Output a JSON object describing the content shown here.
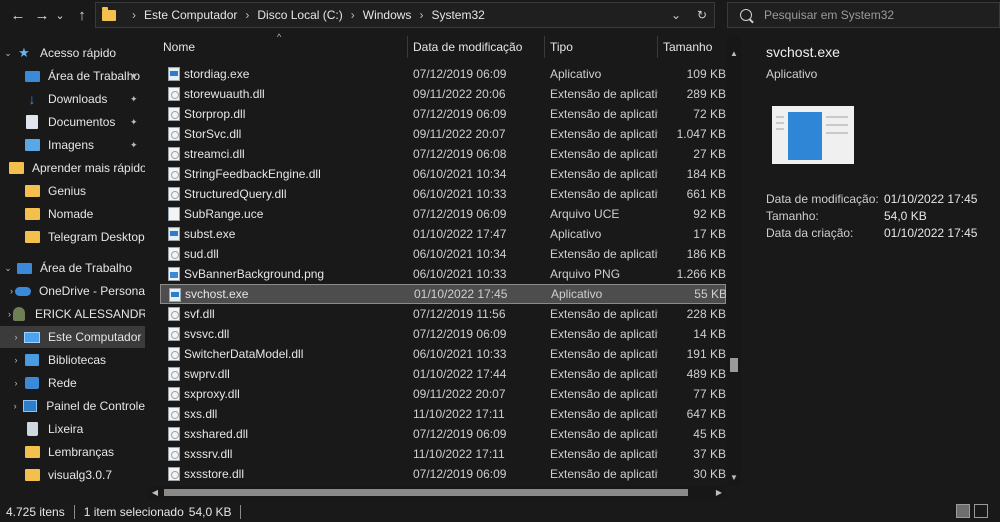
{
  "nav": {
    "back": "←",
    "forward": "→",
    "recent": "⌄",
    "up": "↑"
  },
  "address": {
    "crumbs": [
      "Este Computador",
      "Disco Local (C:)",
      "Windows",
      "System32"
    ],
    "dropdown_icon": "chevron-down-icon",
    "refresh_icon": "refresh-icon"
  },
  "search": {
    "placeholder": "Pesquisar em System32"
  },
  "sidebar": {
    "items": [
      {
        "label": "Acesso rápido",
        "icon": "star-icon"
      },
      {
        "label": "Área de Trabalho",
        "icon": "desktop-icon",
        "pinned": true
      },
      {
        "label": "Downloads",
        "icon": "download-icon",
        "pinned": true
      },
      {
        "label": "Documentos",
        "icon": "document-icon",
        "pinned": true
      },
      {
        "label": "Imagens",
        "icon": "image-icon",
        "pinned": true
      },
      {
        "label": "Aprender mais rápido",
        "icon": "folder-icon"
      },
      {
        "label": "Genius",
        "icon": "folder-icon"
      },
      {
        "label": "Nomade",
        "icon": "folder-icon"
      },
      {
        "label": "Telegram Desktop",
        "icon": "folder-icon"
      },
      {
        "label": "Área de Trabalho",
        "icon": "desktop-icon"
      },
      {
        "label": "OneDrive - Persona",
        "icon": "cloud-icon"
      },
      {
        "label": "ERICK ALESSANDRO",
        "icon": "user-icon"
      },
      {
        "label": "Este Computador",
        "icon": "computer-icon"
      },
      {
        "label": "Bibliotecas",
        "icon": "library-icon"
      },
      {
        "label": "Rede",
        "icon": "network-icon"
      },
      {
        "label": "Painel de Controle",
        "icon": "control-panel-icon"
      },
      {
        "label": "Lixeira",
        "icon": "trash-icon"
      },
      {
        "label": "Lembranças",
        "icon": "folder-icon"
      },
      {
        "label": "visualg3.0.7",
        "icon": "folder-icon"
      }
    ]
  },
  "columns": {
    "name": "Nome",
    "date": "Data de modificação",
    "type": "Tipo",
    "size": "Tamanho"
  },
  "files": [
    {
      "name": "stordiag.exe",
      "date": "07/12/2019 06:09",
      "type": "Aplicativo",
      "size": "109 KB",
      "kind": "exe"
    },
    {
      "name": "storewuauth.dll",
      "date": "09/11/2022 20:06",
      "type": "Extensão de aplicativo",
      "size": "289 KB",
      "kind": "dll"
    },
    {
      "name": "Storprop.dll",
      "date": "07/12/2019 06:09",
      "type": "Extensão de aplicativo",
      "size": "72 KB",
      "kind": "dll"
    },
    {
      "name": "StorSvc.dll",
      "date": "09/11/2022 20:07",
      "type": "Extensão de aplicativo",
      "size": "1.047 KB",
      "kind": "dll"
    },
    {
      "name": "streamci.dll",
      "date": "07/12/2019 06:08",
      "type": "Extensão de aplicativo",
      "size": "27 KB",
      "kind": "dll"
    },
    {
      "name": "StringFeedbackEngine.dll",
      "date": "06/10/2021 10:34",
      "type": "Extensão de aplicativo",
      "size": "184 KB",
      "kind": "dll"
    },
    {
      "name": "StructuredQuery.dll",
      "date": "06/10/2021 10:33",
      "type": "Extensão de aplicativo",
      "size": "661 KB",
      "kind": "dll"
    },
    {
      "name": "SubRange.uce",
      "date": "07/12/2019 06:09",
      "type": "Arquivo UCE",
      "size": "92 KB",
      "kind": "file"
    },
    {
      "name": "subst.exe",
      "date": "01/10/2022 17:47",
      "type": "Aplicativo",
      "size": "17 KB",
      "kind": "exe"
    },
    {
      "name": "sud.dll",
      "date": "06/10/2021 10:34",
      "type": "Extensão de aplicativo",
      "size": "186 KB",
      "kind": "dll"
    },
    {
      "name": "SvBannerBackground.png",
      "date": "06/10/2021 10:33",
      "type": "Arquivo PNG",
      "size": "1.266 KB",
      "kind": "png"
    },
    {
      "name": "svchost.exe",
      "date": "01/10/2022 17:45",
      "type": "Aplicativo",
      "size": "55 KB",
      "kind": "exe",
      "selected": true
    },
    {
      "name": "svf.dll",
      "date": "07/12/2019 11:56",
      "type": "Extensão de aplicativo",
      "size": "228 KB",
      "kind": "dll"
    },
    {
      "name": "svsvc.dll",
      "date": "07/12/2019 06:09",
      "type": "Extensão de aplicativo",
      "size": "14 KB",
      "kind": "dll"
    },
    {
      "name": "SwitcherDataModel.dll",
      "date": "06/10/2021 10:33",
      "type": "Extensão de aplicativo",
      "size": "191 KB",
      "kind": "dll"
    },
    {
      "name": "swprv.dll",
      "date": "01/10/2022 17:44",
      "type": "Extensão de aplicativo",
      "size": "489 KB",
      "kind": "dll"
    },
    {
      "name": "sxproxy.dll",
      "date": "09/11/2022 20:07",
      "type": "Extensão de aplicativo",
      "size": "77 KB",
      "kind": "dll"
    },
    {
      "name": "sxs.dll",
      "date": "11/10/2022 17:11",
      "type": "Extensão de aplicativo",
      "size": "647 KB",
      "kind": "dll"
    },
    {
      "name": "sxshared.dll",
      "date": "07/12/2019 06:09",
      "type": "Extensão de aplicativo",
      "size": "45 KB",
      "kind": "dll"
    },
    {
      "name": "sxssrv.dll",
      "date": "11/10/2022 17:11",
      "type": "Extensão de aplicativo",
      "size": "37 KB",
      "kind": "dll"
    },
    {
      "name": "sxsstore.dll",
      "date": "07/12/2019 06:09",
      "type": "Extensão de aplicativo",
      "size": "30 KB",
      "kind": "dll"
    }
  ],
  "details": {
    "title": "svchost.exe",
    "subtitle": "Aplicativo",
    "props": [
      {
        "label": "Data de modificação:",
        "value": "01/10/2022 17:45"
      },
      {
        "label": "Tamanho:",
        "value": "54,0 KB"
      },
      {
        "label": "Data da criação:",
        "value": "01/10/2022 17:45"
      }
    ]
  },
  "status": {
    "count": "4.725 itens",
    "selected": "1 item selecionado",
    "size": "54,0 KB"
  }
}
